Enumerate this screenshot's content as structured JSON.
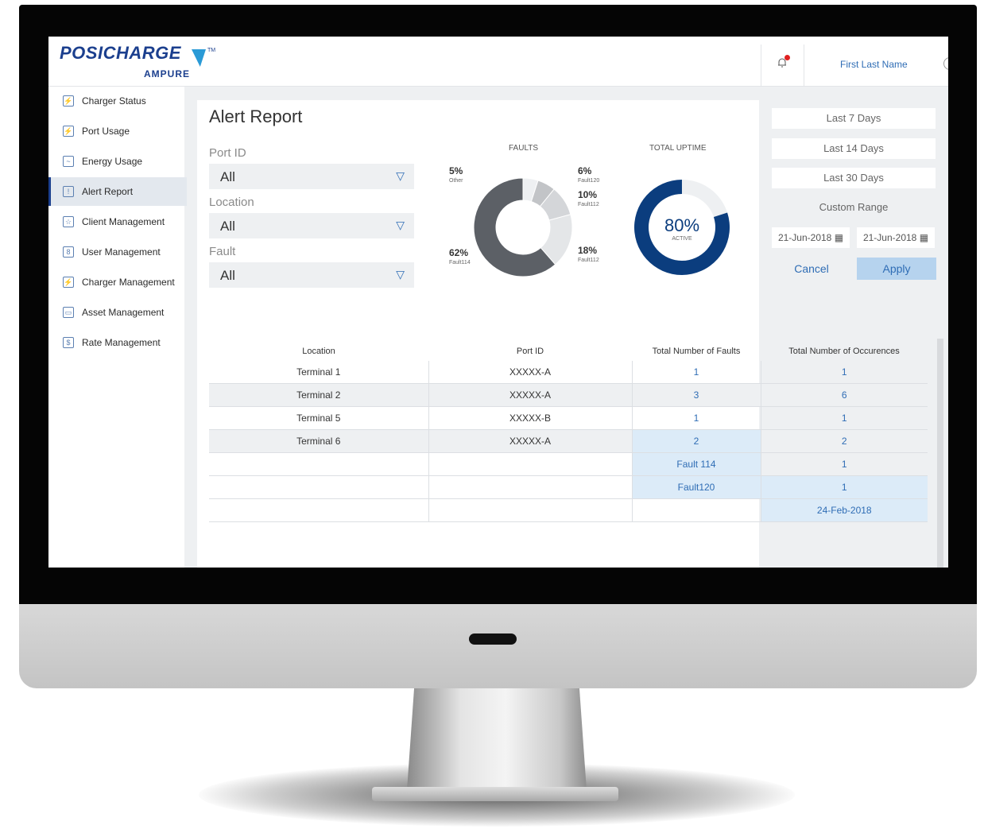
{
  "app": {
    "brand_name": "POSICHARGE",
    "brand_tm": "TM",
    "brand_sub": "AMPURE",
    "user_name": "First Last Name"
  },
  "sidebar": {
    "items": [
      {
        "label": "Charger Status",
        "icon": "charger-icon"
      },
      {
        "label": "Port Usage",
        "icon": "port-icon"
      },
      {
        "label": "Energy Usage",
        "icon": "energy-icon"
      },
      {
        "label": "Alert Report",
        "icon": "alert-icon",
        "active": true
      },
      {
        "label": "Client Management",
        "icon": "client-icon"
      },
      {
        "label": "User Management",
        "icon": "user-icon"
      },
      {
        "label": "Charger Management",
        "icon": "charger-mgmt-icon"
      },
      {
        "label": "Asset Management",
        "icon": "asset-icon"
      },
      {
        "label": "Rate Management",
        "icon": "rate-icon"
      }
    ]
  },
  "report": {
    "title": "Alert Report",
    "filters": [
      {
        "label": "Port ID",
        "value": "All"
      },
      {
        "label": "Location",
        "value": "All"
      },
      {
        "label": "Fault",
        "value": "All"
      }
    ]
  },
  "date_range": {
    "options": [
      "Last 7 Days",
      "Last 14 Days",
      "Last 30 Days"
    ],
    "custom_label": "Custom Range",
    "start_date": "21-Jun-2018",
    "end_date": "21-Jun-2018",
    "cancel_label": "Cancel",
    "apply_label": "Apply"
  },
  "chart_data": [
    {
      "type": "pie",
      "title": "FAULTS",
      "slices": [
        {
          "label": "Other",
          "value": 5
        },
        {
          "label": "Fault120",
          "value": 6
        },
        {
          "label": "Fault112",
          "value": 10
        },
        {
          "label": "Fault112",
          "value": 18
        },
        {
          "label": "Fault114",
          "value": 62
        }
      ],
      "value_labels": [
        "5%",
        "6%",
        "10%",
        "18%",
        "62%"
      ]
    },
    {
      "type": "pie",
      "title": "TOTAL UPTIME",
      "value": 80,
      "value_label": "80%",
      "sub_label": "ACTIVE",
      "colors": {
        "active": "#0b3d7e",
        "rest": "#eef0f2"
      }
    }
  ],
  "table": {
    "headers": [
      "Location",
      "Port ID",
      "Total Number of Faults",
      "Total Number of Occurences"
    ],
    "rows": [
      [
        "Terminal 1",
        "XXXXX-A",
        "1",
        "1"
      ],
      [
        "Terminal 2",
        "XXXXX-A",
        "3",
        "6"
      ],
      [
        "Terminal 5",
        "XXXXX-B",
        "1",
        "1"
      ],
      [
        "Terminal 6",
        "XXXXX-A",
        "2",
        "2"
      ],
      [
        "",
        "",
        "Fault 114",
        "1"
      ],
      [
        "",
        "",
        "Fault120",
        "1"
      ],
      [
        "",
        "",
        "",
        "24-Feb-2018"
      ]
    ]
  },
  "colors": {
    "brand": "#1b3f8e",
    "accent": "#2f6db5",
    "highlight": "#dcebf8",
    "apply_bg": "#b6d3ee"
  }
}
